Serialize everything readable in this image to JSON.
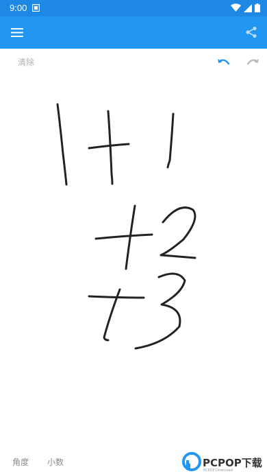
{
  "status_bar": {
    "time": "9:00",
    "notification_icon": "notification-square-icon",
    "wifi_icon": "wifi-icon",
    "signal_icon": "signal-icon",
    "battery_icon": "battery-icon",
    "background_color": "#1e88e5"
  },
  "app_bar": {
    "menu_icon": "menu-icon",
    "share_icon": "share-icon",
    "background_color": "#2196f3"
  },
  "toolbar": {
    "clear_label": "清除",
    "undo_icon": "undo-icon",
    "redo_icon": "redo-icon",
    "undo_color": "#2196f3",
    "redo_color": "#b8b8b8"
  },
  "canvas": {
    "handwriting": "1+1 +2 +3",
    "ink_color": "#222222"
  },
  "bottom_bar": {
    "modes": [
      {
        "label": "角度"
      },
      {
        "label": "小数"
      }
    ]
  },
  "watermark": {
    "text": "PCPOP下载",
    "subtext": "PCPOP Download",
    "brand_color": "#2196f3"
  }
}
